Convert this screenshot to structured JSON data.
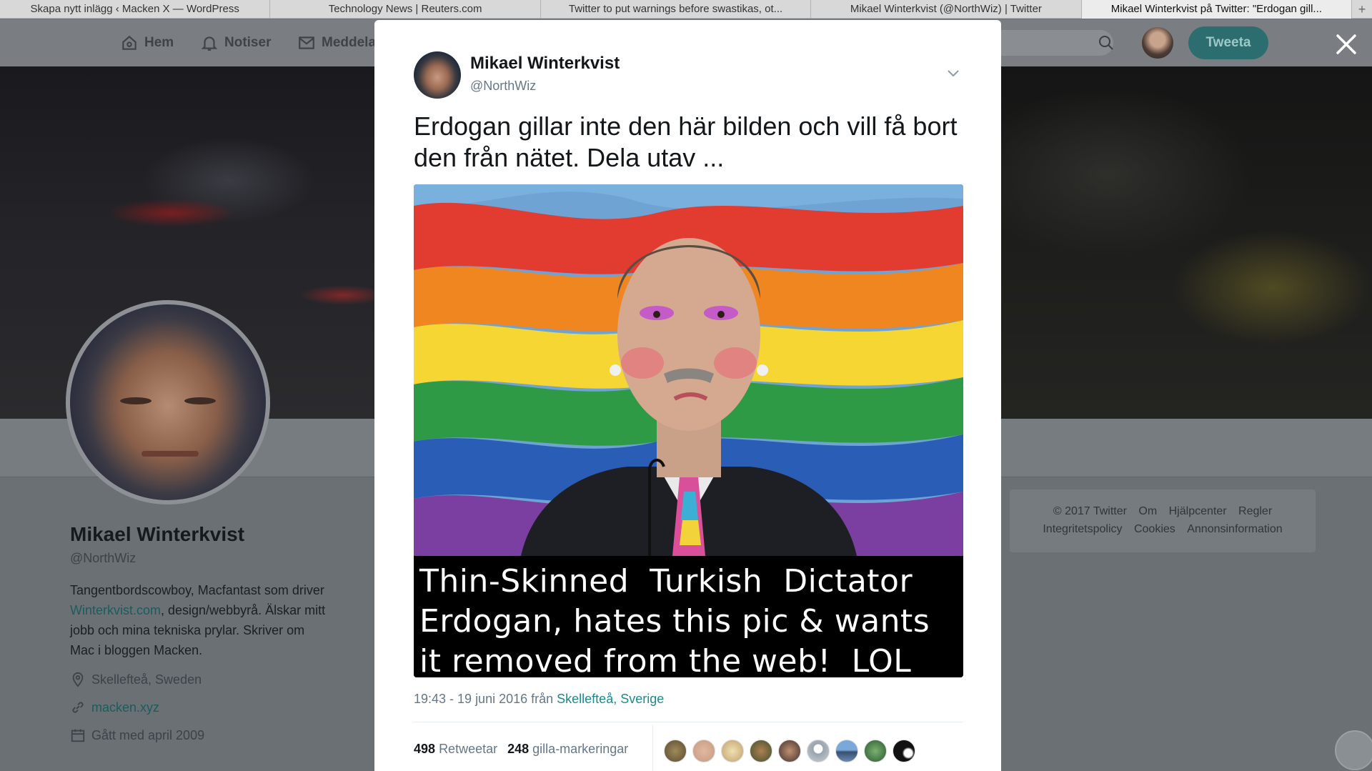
{
  "browser": {
    "tabs": [
      {
        "label": "Skapa nytt inlägg ‹ Macken X — WordPress",
        "active": false
      },
      {
        "label": "Technology News | Reuters.com",
        "active": false
      },
      {
        "label": "Twitter to put warnings before swastikas, ot...",
        "active": false
      },
      {
        "label": "Mikael Winterkvist (@NorthWiz) | Twitter",
        "active": false
      },
      {
        "label": "Mikael Winterkvist på Twitter: \"Erdogan gill...",
        "active": true
      }
    ],
    "add_tab": "+"
  },
  "nav": {
    "home": "Hem",
    "notifications": "Notiser",
    "messages": "Meddela",
    "tweet_button": "Tweeta"
  },
  "profile": {
    "name": "Mikael Winterkvist",
    "handle": "@NorthWiz",
    "bio_1": "Tangentbordscowboy, Macfantast som driver",
    "bio_link": "Winterkvist.com",
    "bio_2": ", design/webbyrå. Älskar mitt",
    "bio_3": "jobb och mina tekniska prylar. Skriver om",
    "bio_4": "Mac i bloggen Macken.",
    "location": "Skellefteå, Sweden",
    "website": "macken.xyz",
    "joined": "Gått med april 2009"
  },
  "footer": {
    "row1": [
      "© 2017 Twitter",
      "Om",
      "Hjälpcenter",
      "Regler"
    ],
    "row2": [
      "Integritetspolicy",
      "Cookies",
      "Annonsinformation"
    ]
  },
  "tweet": {
    "author_name": "Mikael Winterkvist",
    "author_handle": "@NorthWiz",
    "text": "Erdogan gillar inte den här bilden och vill få bort den från nätet. Dela utav ...",
    "image_caption_1": "Thin-Skinned  Turkish  Dictator",
    "image_caption_2": "Erdogan, hates this pic & wants",
    "image_caption_3": "it removed from the web!  LOL",
    "timestamp": "19:43 - 19 juni 2016 från ",
    "place": "Skellefteå, Sverige",
    "retweets_count": "498",
    "retweets_label": "Retweetar",
    "likes_count": "248",
    "likes_label": "gilla-markeringar"
  },
  "colors": {
    "accent": "#1b8a8c",
    "tweet_button": "#2c6e6f",
    "overlay": "#6b7075"
  }
}
